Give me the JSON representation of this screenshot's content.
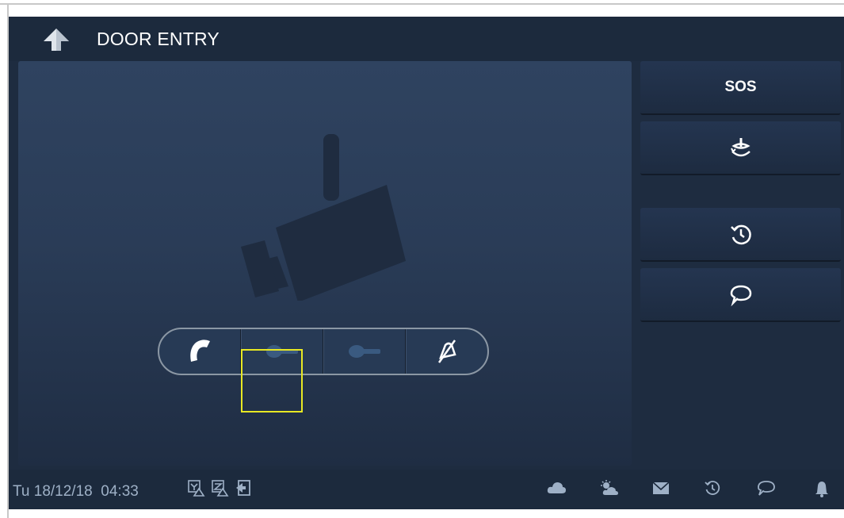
{
  "app": {
    "title": "DOOR ENTRY"
  },
  "side_buttons": {
    "sos_label": "SOS"
  },
  "status": {
    "date": "Tu 18/12/18",
    "time": "04:33"
  },
  "icons": {
    "back": "back-arrow-icon",
    "camera_placeholder": "camera-icon",
    "call": "handset-icon",
    "unlock1": "key-icon",
    "unlock2": "key-icon",
    "mute": "bell-muted-icon",
    "cctv": "surveillance-icon",
    "history": "history-icon",
    "message": "chat-bubble-icon"
  },
  "colors": {
    "highlight": "#e8e823",
    "background": "#1e2c40"
  }
}
